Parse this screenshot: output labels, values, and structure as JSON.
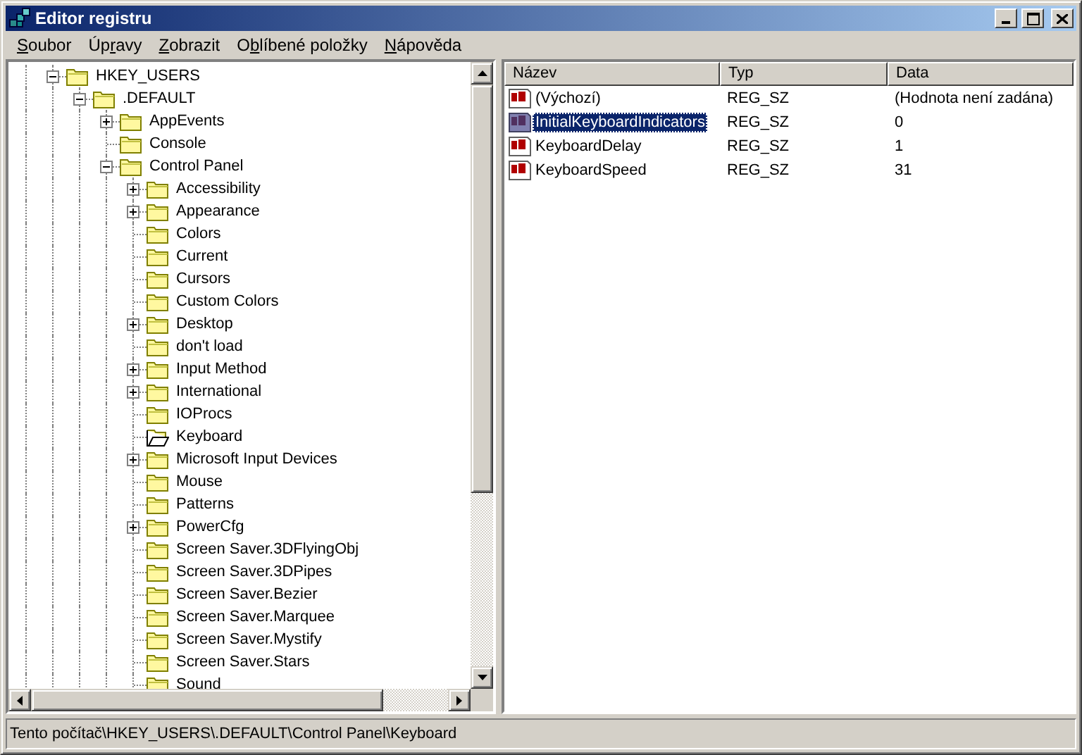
{
  "window": {
    "title": "Editor registru"
  },
  "menu": [
    {
      "key": "S",
      "rest": "oubor"
    },
    {
      "lead": "Úp",
      "key": "r",
      "rest": "avy"
    },
    {
      "key": "Z",
      "rest": "obrazit"
    },
    {
      "lead": "O",
      "key": "b",
      "rest": "líbené položky"
    },
    {
      "key": "N",
      "rest": "ápověda"
    }
  ],
  "tree": [
    {
      "label": "HKEY_USERS",
      "expanded": true,
      "selected": false,
      "children": [
        {
          "label": ".DEFAULT",
          "expanded": true,
          "selected": false,
          "children": [
            {
              "label": "AppEvents",
              "expanded": false,
              "selected": false
            },
            {
              "label": "Console",
              "selected": false
            },
            {
              "label": "Control Panel",
              "expanded": true,
              "selected": false,
              "children": [
                {
                  "label": "Accessibility",
                  "expanded": false,
                  "selected": false
                },
                {
                  "label": "Appearance",
                  "expanded": false,
                  "selected": false
                },
                {
                  "label": "Colors",
                  "selected": false
                },
                {
                  "label": "Current",
                  "selected": false
                },
                {
                  "label": "Cursors",
                  "selected": false
                },
                {
                  "label": "Custom Colors",
                  "selected": false
                },
                {
                  "label": "Desktop",
                  "expanded": false,
                  "selected": false
                },
                {
                  "label": "don't load",
                  "selected": false
                },
                {
                  "label": "Input Method",
                  "expanded": false,
                  "selected": false
                },
                {
                  "label": "International",
                  "expanded": false,
                  "selected": false
                },
                {
                  "label": "IOProcs",
                  "selected": false
                },
                {
                  "label": "Keyboard",
                  "selected": true
                },
                {
                  "label": "Microsoft Input Devices",
                  "expanded": false,
                  "selected": false
                },
                {
                  "label": "Mouse",
                  "selected": false
                },
                {
                  "label": "Patterns",
                  "selected": false
                },
                {
                  "label": "PowerCfg",
                  "expanded": false,
                  "selected": false
                },
                {
                  "label": "Screen Saver.3DFlyingObj",
                  "selected": false
                },
                {
                  "label": "Screen Saver.3DPipes",
                  "selected": false
                },
                {
                  "label": "Screen Saver.Bezier",
                  "selected": false
                },
                {
                  "label": "Screen Saver.Marquee",
                  "selected": false
                },
                {
                  "label": "Screen Saver.Mystify",
                  "selected": false
                },
                {
                  "label": "Screen Saver.Stars",
                  "selected": false
                },
                {
                  "label": "Sound",
                  "selected": false
                }
              ]
            }
          ]
        }
      ]
    }
  ],
  "values": {
    "columns": [
      "Název",
      "Typ",
      "Data"
    ],
    "rows": [
      {
        "name": "(Výchozí)",
        "type": "REG_SZ",
        "data": "(Hodnota není zadána)",
        "selected": false
      },
      {
        "name": "InitialKeyboardIndicators",
        "type": "REG_SZ",
        "data": "0",
        "selected": true
      },
      {
        "name": "KeyboardDelay",
        "type": "REG_SZ",
        "data": "1",
        "selected": false
      },
      {
        "name": "KeyboardSpeed",
        "type": "REG_SZ",
        "data": "31",
        "selected": false
      }
    ]
  },
  "status_bar": "Tento počítač\\HKEY_USERS\\.DEFAULT\\Control Panel\\Keyboard"
}
